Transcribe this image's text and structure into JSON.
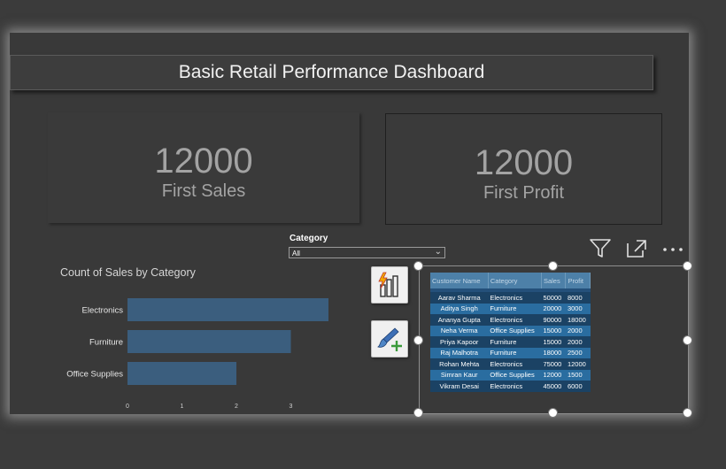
{
  "title": "Basic Retail Performance Dashboard",
  "kpis": [
    {
      "value": "12000",
      "label": "First Sales"
    },
    {
      "value": "12000",
      "label": "First Profit"
    }
  ],
  "slicer": {
    "title": "Category",
    "value": "All"
  },
  "chart": {
    "title": "Count of Sales by Category",
    "icons": [
      "filter-icon",
      "focus-mode-icon",
      "more-options-icon"
    ]
  },
  "chart_data": {
    "type": "bar",
    "orientation": "horizontal",
    "title": "Count of Sales by Category",
    "categories": [
      "Electronics",
      "Furniture",
      "Office Supplies"
    ],
    "values": [
      4,
      3,
      2
    ],
    "xlim": [
      0,
      4
    ],
    "xticks": [
      "0",
      "1",
      "2",
      "3",
      "4"
    ],
    "bar_color": "#3b5e7e"
  },
  "tools": [
    "build-visual-icon",
    "format-visual-icon"
  ],
  "table": {
    "headers": [
      "Customer Name",
      "Category",
      "Sales",
      "Profit"
    ],
    "rows": [
      [
        "Aarav Sharma",
        "Electronics",
        "50000",
        "8000"
      ],
      [
        "Aditya Singh",
        "Furniture",
        "20000",
        "3000"
      ],
      [
        "Ananya Gupta",
        "Electronics",
        "90000",
        "18000"
      ],
      [
        "Neha Verma",
        "Office Supplies",
        "15000",
        "2000"
      ],
      [
        "Priya Kapoor",
        "Furniture",
        "15000",
        "2000"
      ],
      [
        "Raj Malhotra",
        "Furniture",
        "18000",
        "2500"
      ],
      [
        "Rohan Mehta",
        "Electronics",
        "75000",
        "12000"
      ],
      [
        "Simran Kaur",
        "Office Supplies",
        "12000",
        "1500"
      ],
      [
        "Vikram Desai",
        "Electronics",
        "45000",
        "6000"
      ]
    ]
  },
  "colors": {
    "canvas": "#393939",
    "table_header": "#4d80a8",
    "table_row_dark": "#1b4264",
    "table_row_light": "#2a6da0"
  }
}
